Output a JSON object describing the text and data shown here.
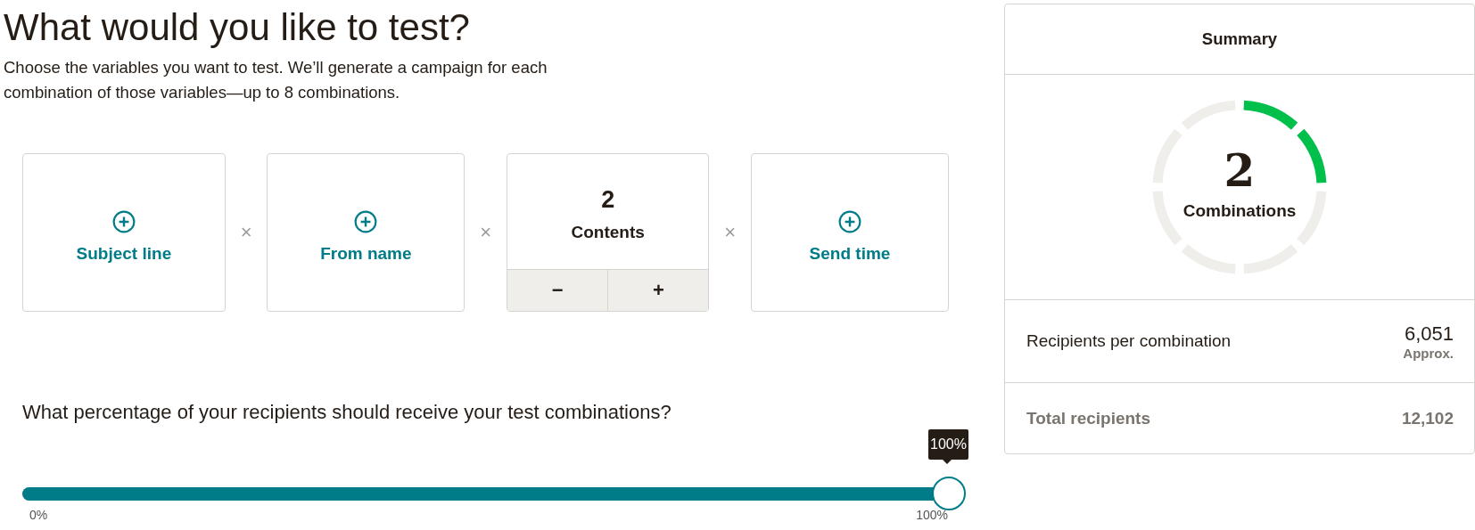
{
  "heading": "What would you like to test?",
  "description": "Choose the variables you want to test. We’ll generate a campaign for each combination of those variables—up to 8 combinations.",
  "variables": [
    {
      "kind": "add",
      "label": "Subject line"
    },
    {
      "kind": "add",
      "label": "From name"
    },
    {
      "kind": "counter",
      "value": "2",
      "label": "Contents",
      "decrement": "−",
      "increment": "+"
    },
    {
      "kind": "add",
      "label": "Send time"
    }
  ],
  "separator": "×",
  "percentage": {
    "question": "What percentage of your recipients should receive your test combinations?",
    "level": 1,
    "tooltip": "100%",
    "min_label": "0%",
    "max_label": "100%"
  },
  "summary": {
    "title": "Summary",
    "count": "2",
    "count_label": "Combinations",
    "segments": [
      {
        "filled": true
      },
      {
        "filled": true
      },
      {
        "filled": false
      },
      {
        "filled": false
      },
      {
        "filled": false
      },
      {
        "filled": false
      },
      {
        "filled": false
      },
      {
        "filled": false
      }
    ],
    "per_combination_label": "Recipients per combination",
    "per_combination_value": "6,051",
    "per_combination_note": "Approx.",
    "total_label": "Total recipients",
    "total_value": "12,102"
  }
}
